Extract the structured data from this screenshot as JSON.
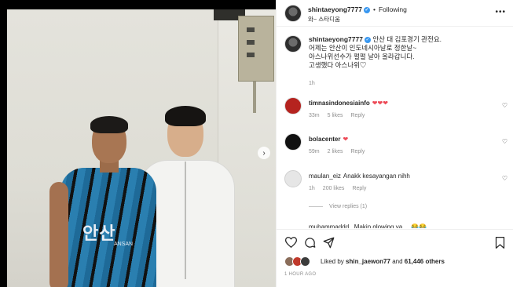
{
  "post": {
    "author": "shintaeyong7777",
    "header_separator": "•",
    "follow_label": "Following",
    "location": "와~ 스타디움",
    "caption_author": "shintaeyong7777",
    "caption_lines": "안산 대 김포경기 관전요.\n어제는 안산이 인도네시아날로 정한날~\n아스나위선수가 펄펄 날아 올라갑니다.\n고생했다 아스나위♡",
    "caption_time": "1h",
    "photo_shirt_text": "안산",
    "photo_shirt_sub": "ANSAN"
  },
  "comments": [
    {
      "username": "timnasindonesiainfo",
      "text": "❤❤❤",
      "time": "33m",
      "likes": "5 likes",
      "reply": "Reply",
      "avatar_color": "#c0392b"
    },
    {
      "username": "bolacenter",
      "text": "❤",
      "time": "59m",
      "likes": "2 likes",
      "reply": "Reply",
      "avatar_color": "#111111"
    },
    {
      "username": "maulan_eiz",
      "text": "Anakk kesayangan nihh",
      "time": "1h",
      "likes": "200 likes",
      "reply": "Reply",
      "avatar_color": "#e6e6e6"
    }
  ],
  "view_replies": "View replies (1)",
  "cut_comment": "muhammaddd_  Makin  glowing ya ... 😂😂",
  "actions": {
    "likes_prefix": "Liked by",
    "liked_by_user": "shin_jaewon77",
    "likes_conj": "and",
    "likes_others": "61,446 others",
    "timestamp": "1 HOUR AGO"
  },
  "colors": {
    "verified": "#3897f0",
    "heart": "#ed4956",
    "muted": "#8e8e8e"
  },
  "icons": [
    "more-icon",
    "verified-icon",
    "heart-icon",
    "comment-icon",
    "share-icon",
    "bookmark-icon",
    "chevron-right-icon"
  ]
}
